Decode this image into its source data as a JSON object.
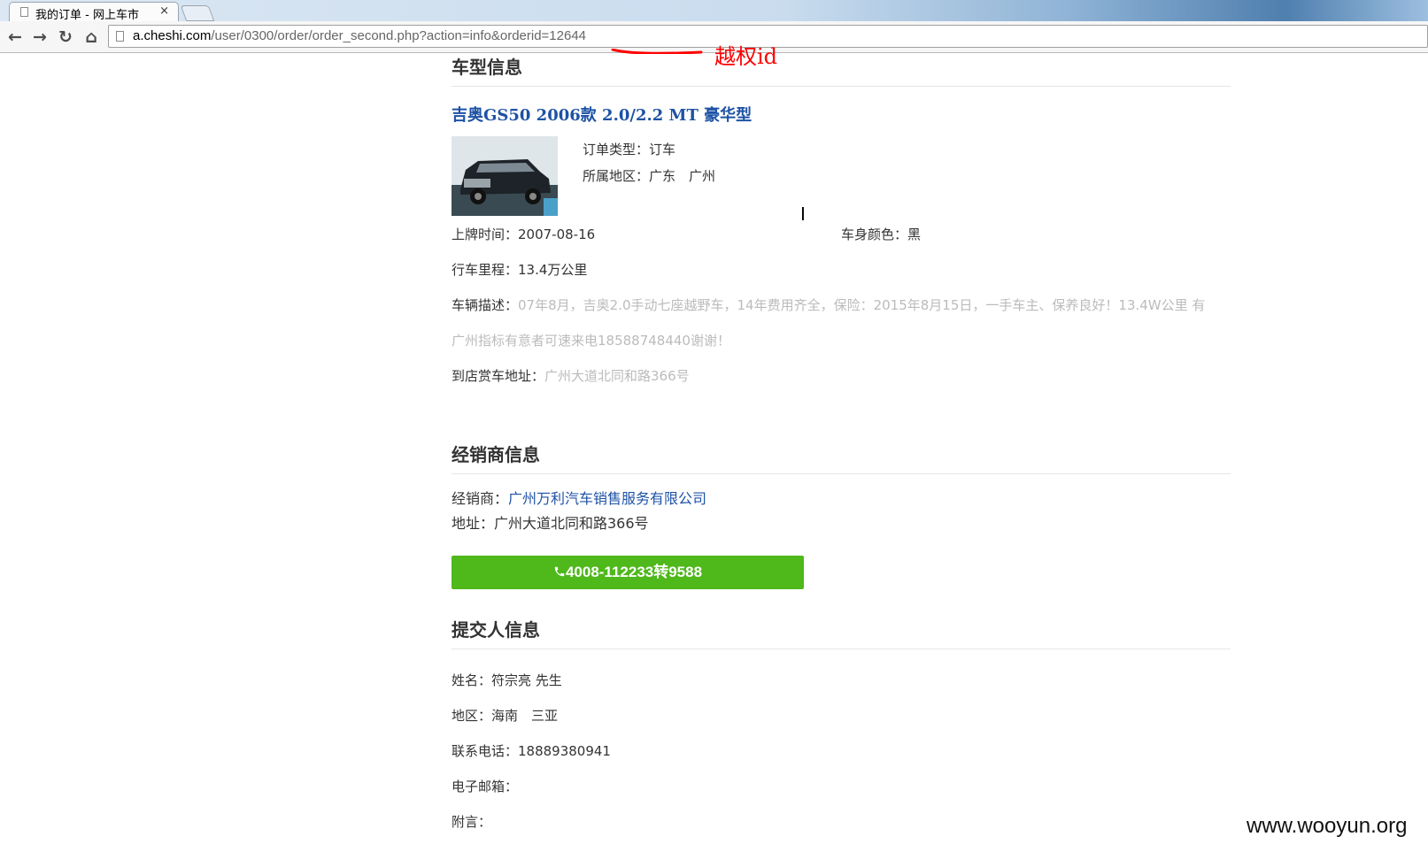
{
  "browser": {
    "tab_title": "我的订单 - 网上车市",
    "tab_close": "×",
    "url_host": "a.cheshi.com",
    "url_path": "/user/0300/order/order_second.php?action=info&orderid=12644",
    "nav_back": "←",
    "nav_forward": "→",
    "nav_reload": "↻",
    "nav_home": "⌂"
  },
  "annotation": {
    "text": "越权id",
    "color": "#ff0000"
  },
  "car_section": {
    "title": "车型信息",
    "car_name": "吉奥GS50 2006款 2.0/2.2 MT 豪华型",
    "order_type": "订单类型：订车",
    "region": "所属地区：广东　广州",
    "plate_date": "上牌时间：2007-08-16",
    "body_color": "车身颜色：黑",
    "mileage": "行车里程：13.4万公里",
    "desc_label": "车辆描述：",
    "desc_line1": "07年8月，吉奥2.0手动七座越野车，14年费用齐全，保险：2015年8月15日，一手车主、保养良好！13.4W公里 有",
    "desc_line2": "广州指标有意者可速来电18588748440谢谢！",
    "store_label": "到店赏车地址：",
    "store_address": "广州大道北同和路366号"
  },
  "dealer_section": {
    "title": "经销商信息",
    "dealer_label": "经销商：",
    "dealer_name": "广州万利汽车销售服务有限公司",
    "address": "地址：广州大道北同和路366号",
    "phone_button": "4008-112233转9588"
  },
  "submitter_section": {
    "title": "提交人信息",
    "name": "姓名：符宗亮 先生",
    "region": "地区：海南　三亚",
    "phone": "联系电话：18889380941",
    "email": "电子邮箱：",
    "note": "附言："
  },
  "watermark": "www.wooyun.org",
  "colors": {
    "link": "#1e52a5",
    "button": "#4fb81b",
    "muted": "#bbbbbb"
  },
  "icons": [
    "document-icon",
    "back-arrow-icon",
    "forward-arrow-icon",
    "reload-icon",
    "home-icon",
    "phone-icon",
    "text-cursor-icon"
  ]
}
